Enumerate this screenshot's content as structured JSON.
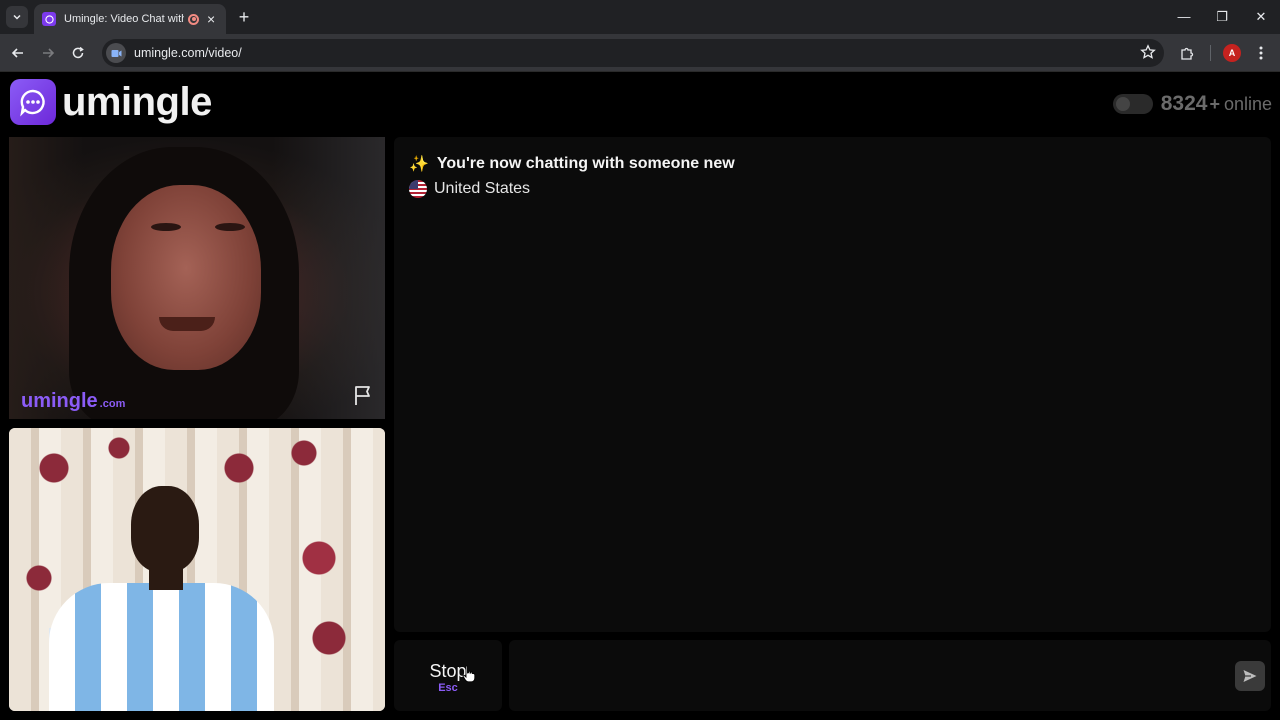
{
  "browser": {
    "tab_title": "Umingle: Video Chat with S",
    "new_tab_label": "+",
    "url": "umingle.com/video/",
    "profile_initial": "A",
    "window_controls": {
      "minimize": "—",
      "restore": "❐",
      "close": "✕"
    }
  },
  "header": {
    "logo_text": "umingle",
    "online_count": "8324",
    "online_plus": "+",
    "online_label": "online"
  },
  "stranger_video": {
    "watermark": "umingle",
    "watermark_suffix": ".com"
  },
  "chat": {
    "status_message": "You're now chatting with someone new",
    "status_icon": "✨",
    "country": "United States"
  },
  "controls": {
    "stop_label": "Stop",
    "stop_shortcut": "Esc",
    "message_placeholder": ""
  },
  "colors": {
    "accent": "#8b5cf6",
    "background": "#000000",
    "panel": "#0b0b0b",
    "browser_chrome": "#35363a"
  }
}
